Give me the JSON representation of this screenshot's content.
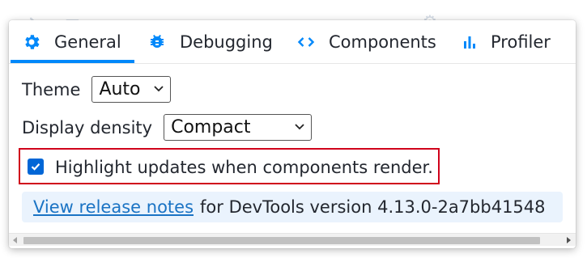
{
  "tabs": [
    {
      "label": "General",
      "icon": "gear-icon",
      "active": true
    },
    {
      "label": "Debugging",
      "icon": "bug-icon",
      "active": false
    },
    {
      "label": "Components",
      "icon": "code-brackets-icon",
      "active": false
    },
    {
      "label": "Profiler",
      "icon": "bar-chart-icon",
      "active": false
    }
  ],
  "settings": {
    "theme_label": "Theme",
    "theme_value": "Auto",
    "density_label": "Display density",
    "density_value": "Compact",
    "highlight_checked": true,
    "highlight_label": "Highlight updates when components render."
  },
  "release": {
    "link_text": "View release notes",
    "version_text": "for DevTools version 4.13.0-2a7bb41548"
  },
  "colors": {
    "accent": "#0088fa",
    "link": "#1a73c4",
    "callout_bg": "#eaf3fd",
    "highlight_border": "#d0021b",
    "checkbox": "#0066d6"
  }
}
